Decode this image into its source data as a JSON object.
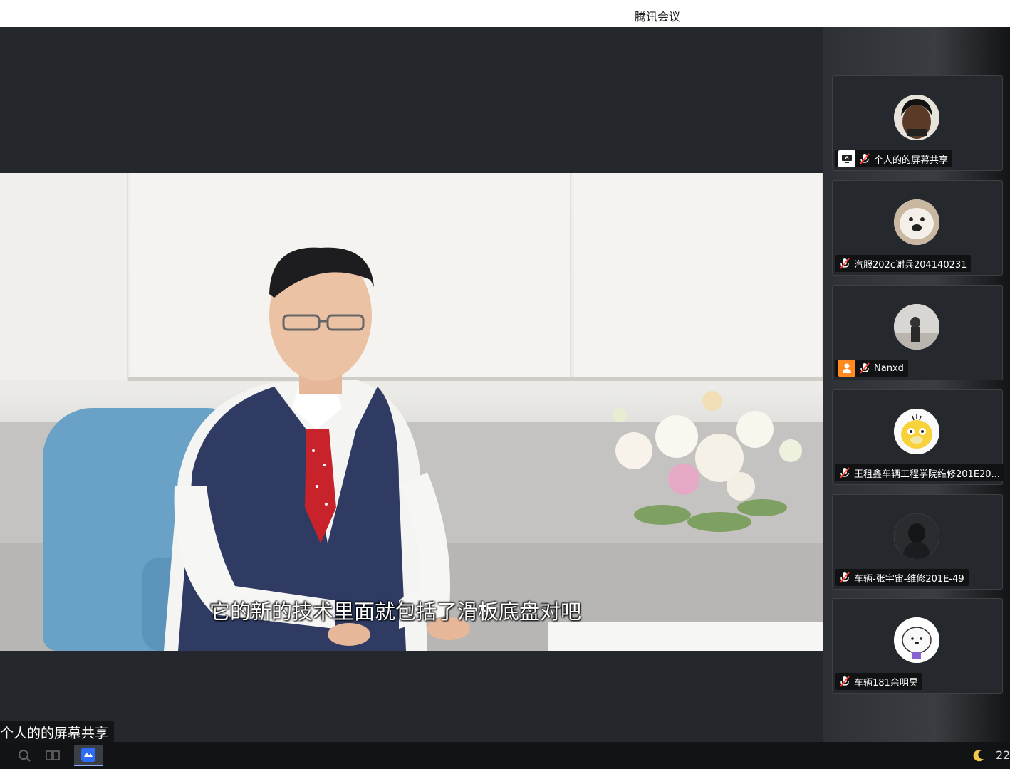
{
  "window": {
    "title": "腾讯会议"
  },
  "video": {
    "subtitle": "它的新的技术里面就包括了滑板底盘对吧"
  },
  "share_label": "个人的的屏幕共享",
  "participants": [
    {
      "name": "个人的的屏幕共享",
      "sharing": true,
      "muted": true
    },
    {
      "name": "汽服202c谢兵204140231",
      "muted": true
    },
    {
      "name": "Nanxd",
      "host": true,
      "muted": true
    },
    {
      "name": "王租鑫车辆工程学院维修201E20...",
      "muted": true
    },
    {
      "name": "车辆-张宇宙-维修201E-49",
      "muted": true
    },
    {
      "name": "车辆181余明昊",
      "muted": true
    }
  ],
  "taskbar": {
    "clock": "22"
  },
  "icons": {
    "screen_share": "screen-share-icon",
    "mic_muted": "mic-muted-icon",
    "host": "host-icon",
    "search": "search-icon",
    "taskview": "task-view-icon",
    "app": "tencent-meeting-icon",
    "moon": "moon-icon"
  },
  "colors": {
    "accent": "#ff8a1f",
    "mute_red": "#ff3b30",
    "sidebar_bg": "#25292d"
  }
}
